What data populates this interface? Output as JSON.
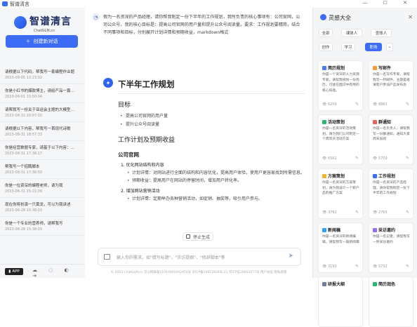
{
  "window": {
    "title": "智谱清言",
    "controls": "— ☐ ✕"
  },
  "sidebar": {
    "brand_name": "智谱清言",
    "brand_sub": "ChatGLM.cn",
    "new_chat_label": "创建新对话",
    "conversations": [
      {
        "title": "请根据以下代码，帮我写一套编程作业题",
        "date": "2023-09-05 13:23:02"
      },
      {
        "title": "你是小红书的爆款博主，请给产品一篇内容",
        "date": "2023-09-01 10:50:04"
      },
      {
        "title": "请帮我写一份关于亚运会主题的大模型宣传稿",
        "date": "2023-08-31 20:07:02"
      },
      {
        "title": "请根据以下内容，帮我写一首现代诗歌",
        "date": "2023-08-31 18:57:33"
      },
      {
        "title": "你是经营数据专家，请基于以下内容：小...",
        "date": "2023-08-31 17:36:17"
      },
      {
        "title": "帮我写一个招聘脚本",
        "date": "2023-08-31 17:36:50"
      },
      {
        "title": "你是一位资深的编程老师，请为我",
        "date": "2023-08-31 15:21:09"
      },
      {
        "title": "现在你将扮演一只黄龙，可以为我讲述",
        "date": "2023-08-28 15:38:03"
      },
      {
        "title": "你是一个专业的营养师，请帮我写",
        "date": "2023-08-28 15:38:03"
      }
    ],
    "app_label": "APP",
    "footer_icons": "☁ ◌ ◐ ⇥"
  },
  "main": {
    "prompt": "假为一名资深的产品经理，请你帮我制定一份下半年的工作规划，我所负责的核心事项有：公司官网，公司公众号。我的核心目标是：提高公司官网的用户量和提升公众号阅读量。要求：工作规划要精简，结合不同事项和目标，分别展开计划详情和预期收益，markdown格式",
    "doc": {
      "title": "下半年工作规划",
      "goals_heading": "目标",
      "goals": [
        "提高公司官网的用户量",
        "提升公众号阅读量"
      ],
      "plan_heading": "工作计划及预期收益",
      "section_heading": "公司官网",
      "item1": "1. 优化网站结构和内容",
      "item1_subs": [
        "计划详情：对网站进行全面的结构和内容优化，提高用户体验，使用户更容易找到所需信息。",
        "预期收益：提高用户在网站的停留时间，增加用户转化率。"
      ],
      "item2": "2. 增加网站营销活动",
      "item2_sub": "计划详情：定期举办各种营销活动，如促销、抽奖等，吸引用户参与。"
    },
    "stop_label": "停止生成",
    "input_placeholder": "输入你的需求，如\"撰写标题\"、\"实访提纲\"、\"修辞脚本\"等",
    "footer": "© 2023 ChatGLM.cn 京公网安备11010802042454号 京ICP备20011824号-21 京ICP证20052077号 用户协议 隐私政策"
  },
  "panel": {
    "title": "灵感大全",
    "close": "✕",
    "tabs": [
      "全部",
      "课体人",
      "查账人",
      "创作",
      "学习",
      "职场",
      "⌄"
    ],
    "active_tab": "职场",
    "cards": [
      {
        "title": "简历规划",
        "desc": "你是一个资深的人力资源专家，请帮我规划一份简历，可能在面试中有用的核心技能。",
        "stat": "6209",
        "color": "#4a7cf6"
      },
      {
        "title": "写邮件",
        "desc": "你是一名写作专家，请帮我写一封邮件，主题是邀请客户参加产品发布会",
        "stat": "8862",
        "color": "#f29b38"
      },
      {
        "title": "活动策划",
        "desc": "你是一名资深的活动策划，请为我们公司制定一个周年庆活动方案",
        "stat": "6562",
        "color": "#2bb673"
      },
      {
        "title": "群通知",
        "desc": "你是一名负责人，请帮我写一份群通知，通知大家周末加班",
        "stat": "5709",
        "color": "#e9635b"
      },
      {
        "title": "方案策划",
        "desc": "你是一名资深的方案策划，请为我设计一个新产品的推广方案",
        "stat": "3782",
        "color": "#f3b331"
      },
      {
        "title": "工作规划",
        "desc": "你是一名资深的产品经理，请你帮我制定一份下半年的工作规划",
        "stat": "2765",
        "color": "#3c6cf5"
      },
      {
        "title": "新闻稿",
        "desc": "你是一名资深的新闻编辑，请帮我写一篇新闻稿",
        "stat": "3190",
        "color": "#34a3f2"
      },
      {
        "title": "采访邀约",
        "desc": "你是一名记者，请帮我写一封采访邀约",
        "stat": "5732",
        "color": "#9b6cf0"
      },
      {
        "title": "研报大纲",
        "desc": "",
        "stat": "",
        "color": "#6f7e9c"
      },
      {
        "title": "简历润色",
        "desc": "",
        "stat": "",
        "color": "#2bb673"
      }
    ]
  }
}
